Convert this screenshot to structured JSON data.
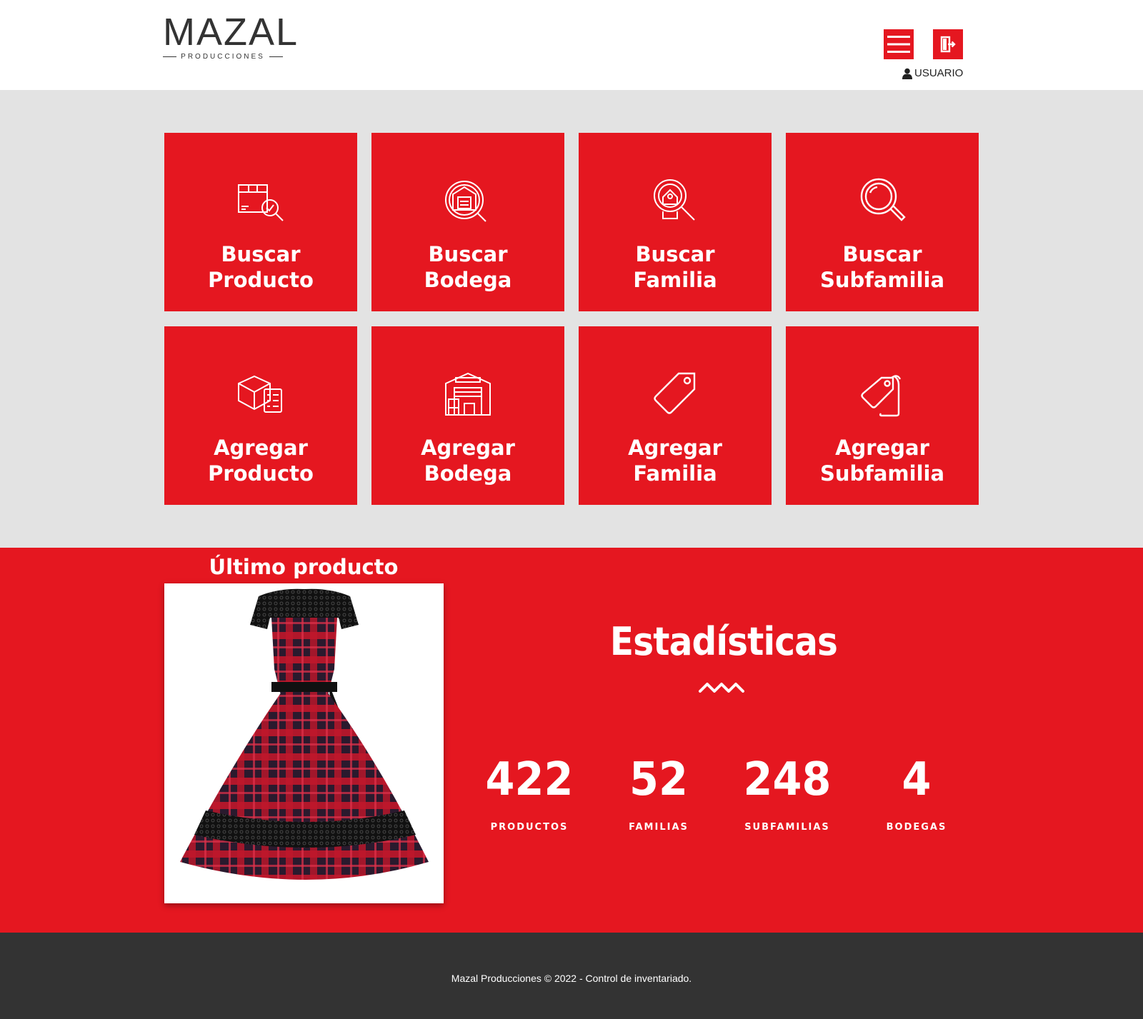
{
  "brand": {
    "logo_text": "MAZAL",
    "logo_sub": "PRODUCCIONES"
  },
  "header": {
    "user_label": "USUARIO"
  },
  "tiles": [
    {
      "line1": "Buscar",
      "line2": "Producto",
      "icon": "box-search-icon"
    },
    {
      "line1": "Buscar",
      "line2": "Bodega",
      "icon": "warehouse-search-icon"
    },
    {
      "line1": "Buscar",
      "line2": "Familia",
      "icon": "home-search-icon"
    },
    {
      "line1": "Buscar",
      "line2": "Subfamilia",
      "icon": "magnifier-icon"
    },
    {
      "line1": "Agregar",
      "line2": "Producto",
      "icon": "box-checklist-icon"
    },
    {
      "line1": "Agregar",
      "line2": "Bodega",
      "icon": "warehouse-icon"
    },
    {
      "line1": "Agregar",
      "line2": "Familia",
      "icon": "tag-icon"
    },
    {
      "line1": "Agregar",
      "line2": "Subfamilia",
      "icon": "double-tag-icon"
    }
  ],
  "last_product": {
    "title": "Último producto"
  },
  "stats": {
    "title": "Estadísticas",
    "items": [
      {
        "value": "422",
        "label": "PRODUCTOS"
      },
      {
        "value": "52",
        "label": "FAMILIAS"
      },
      {
        "value": "248",
        "label": "SUBFAMILIAS"
      },
      {
        "value": "4",
        "label": "BODEGAS"
      }
    ]
  },
  "footer": {
    "copyright": "Mazal Producciones © 2022 - Control de inventariado."
  },
  "colors": {
    "accent": "#e51720",
    "panel_bg": "#e3e3e3",
    "footer_bg": "#333333"
  }
}
